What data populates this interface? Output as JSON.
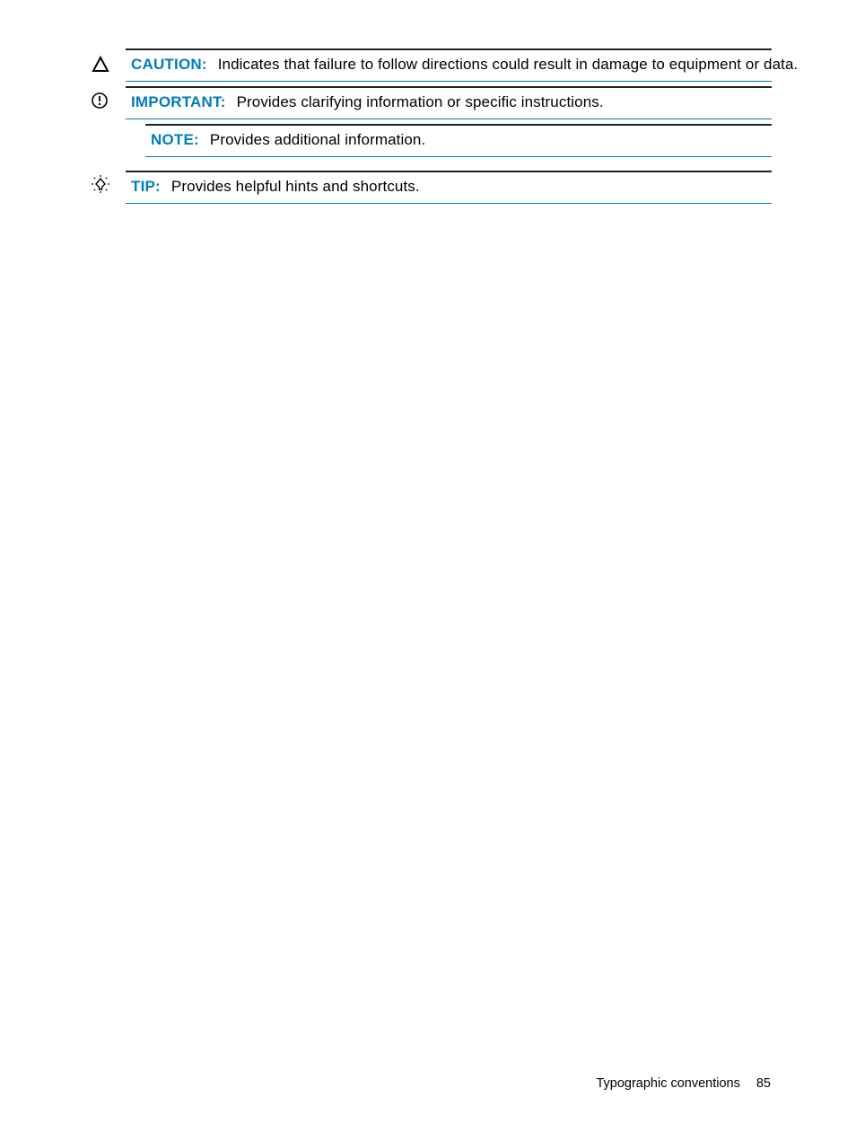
{
  "items": [
    {
      "icon": "caution",
      "label": "CAUTION:",
      "desc": "Indicates that failure to follow directions could result in damage to equipment or data."
    },
    {
      "icon": "important",
      "label": "IMPORTANT:",
      "desc": "Provides clarifying information or specific instructions."
    },
    {
      "icon": "",
      "label": "NOTE:",
      "desc": "Provides additional information."
    },
    {
      "icon": "tip",
      "label": "TIP:",
      "desc": "Provides helpful hints and shortcuts."
    }
  ],
  "footer": {
    "section": "Typographic conventions",
    "page": "85"
  }
}
